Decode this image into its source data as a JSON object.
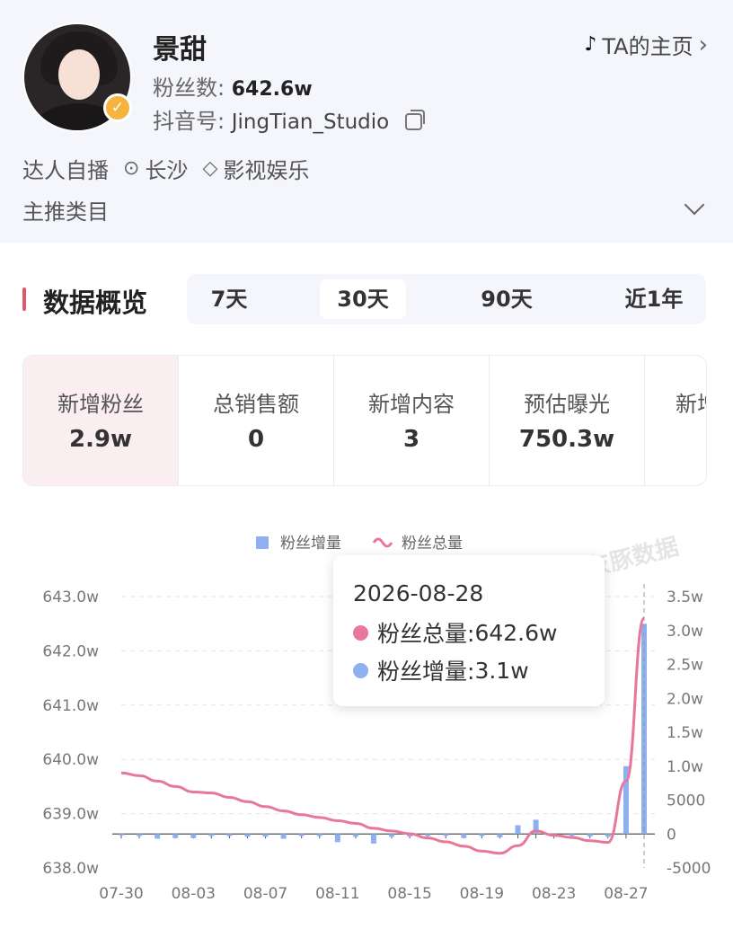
{
  "profile": {
    "name": "景甜",
    "fans_label": "粉丝数:",
    "fans_value": "642.6w",
    "douyin_label": "抖音号:",
    "douyin_id": "JingTian_Studio",
    "home_link": "TA的主页",
    "tag_type": "达人自播",
    "tag_city": "长沙",
    "tag_category": "影视娱乐",
    "main_category_label": "主推类目"
  },
  "overview": {
    "title": "数据概览",
    "ranges": [
      "7天",
      "30天",
      "90天",
      "近1年"
    ],
    "active_range": "30天",
    "metrics": [
      {
        "label": "新增粉丝",
        "value": "2.9w"
      },
      {
        "label": "总销售额",
        "value": "0"
      },
      {
        "label": "新增内容",
        "value": "3"
      },
      {
        "label": "预估曝光",
        "value": "750.3w"
      },
      {
        "label": "新增",
        "value": ""
      }
    ]
  },
  "tooltip": {
    "date": "2026-08-28",
    "total_label": "粉丝总量:",
    "total_value": "642.6w",
    "gain_label": "粉丝增量:",
    "gain_value": "3.1w"
  },
  "watermark": "灰豚数据",
  "colors": {
    "accent": "#e0566f",
    "bar": "#8fb0f0",
    "line": "#e8789b"
  },
  "chart_data": {
    "type": "bar+line",
    "legend": [
      "粉丝增量",
      "粉丝总量"
    ],
    "x_ticks": [
      "07-30",
      "08-03",
      "08-07",
      "08-11",
      "08-15",
      "08-19",
      "08-23",
      "08-27"
    ],
    "y_left_ticks": [
      "643.0w",
      "642.0w",
      "641.0w",
      "640.0w",
      "639.0w",
      "638.0w"
    ],
    "y_right_ticks": [
      "3.5w",
      "3.0w",
      "2.5w",
      "2.0w",
      "1.5w",
      "1.0w",
      "5000",
      "0",
      "-5000"
    ],
    "y_left_range": [
      638.0,
      643.0
    ],
    "y_right_range": [
      -5000,
      35000
    ],
    "dates": [
      "07-30",
      "07-31",
      "08-01",
      "08-02",
      "08-03",
      "08-04",
      "08-05",
      "08-06",
      "08-07",
      "08-08",
      "08-09",
      "08-10",
      "08-11",
      "08-12",
      "08-13",
      "08-14",
      "08-15",
      "08-16",
      "08-17",
      "08-18",
      "08-19",
      "08-20",
      "08-21",
      "08-22",
      "08-23",
      "08-24",
      "08-25",
      "08-26",
      "08-27",
      "08-28"
    ],
    "series": [
      {
        "name": "粉丝增量",
        "type": "bar",
        "values": [
          -50,
          -300,
          -700,
          -600,
          -600,
          -300,
          -300,
          -400,
          -400,
          -700,
          -300,
          -300,
          -1200,
          -400,
          -1400,
          -400,
          -350,
          -300,
          -250,
          -600,
          -300,
          -500,
          1300,
          2100,
          -200,
          -250,
          -350,
          -400,
          10000,
          31000
        ]
      },
      {
        "name": "粉丝总量",
        "type": "line",
        "values": [
          639.75,
          639.7,
          639.6,
          639.5,
          639.4,
          639.38,
          639.3,
          639.22,
          639.13,
          639.05,
          638.98,
          638.93,
          638.87,
          638.82,
          638.73,
          638.68,
          638.63,
          638.55,
          638.48,
          638.4,
          638.31,
          638.27,
          638.41,
          638.68,
          638.6,
          638.56,
          638.5,
          638.47,
          639.6,
          642.6
        ]
      }
    ]
  }
}
